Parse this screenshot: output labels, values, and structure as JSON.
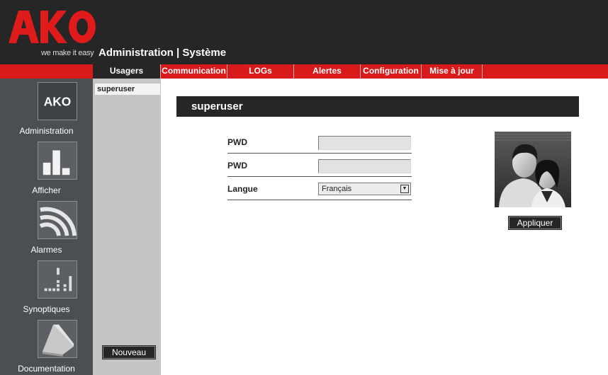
{
  "header": {
    "logo_text": "AKO",
    "tagline": "we make it easy",
    "title": "Administration |  Système"
  },
  "tabs": [
    {
      "label": "Usagers",
      "active": true
    },
    {
      "label": "Communication",
      "active": false
    },
    {
      "label": "LOGs",
      "active": false
    },
    {
      "label": "Alertes",
      "active": false
    },
    {
      "label": "Configuration",
      "active": false
    },
    {
      "label": "Mise à jour",
      "active": false
    }
  ],
  "sidebar": {
    "items": [
      {
        "label": "Administration",
        "icon": "ako-logo-icon"
      },
      {
        "label": "Afficher",
        "icon": "bar-chart-icon"
      },
      {
        "label": "Alarmes",
        "icon": "alarm-waves-icon"
      },
      {
        "label": "Synoptiques",
        "icon": "synoptic-icon"
      },
      {
        "label": "Documentation",
        "icon": "book-icon"
      }
    ]
  },
  "users": {
    "list": [
      "superuser"
    ],
    "new_button": "Nouveau"
  },
  "panel": {
    "title": "superuser",
    "fields": [
      {
        "label": "PWD",
        "value": ""
      },
      {
        "label": "PWD",
        "value": ""
      }
    ],
    "language": {
      "label": "Langue",
      "value": "Français"
    },
    "apply_button": "Appliquer"
  },
  "colors": {
    "header_bg": "#262626",
    "accent_red": "#d81a1a",
    "sidebar_bg": "#4b4f53",
    "list_bg": "#c4c4c4"
  }
}
